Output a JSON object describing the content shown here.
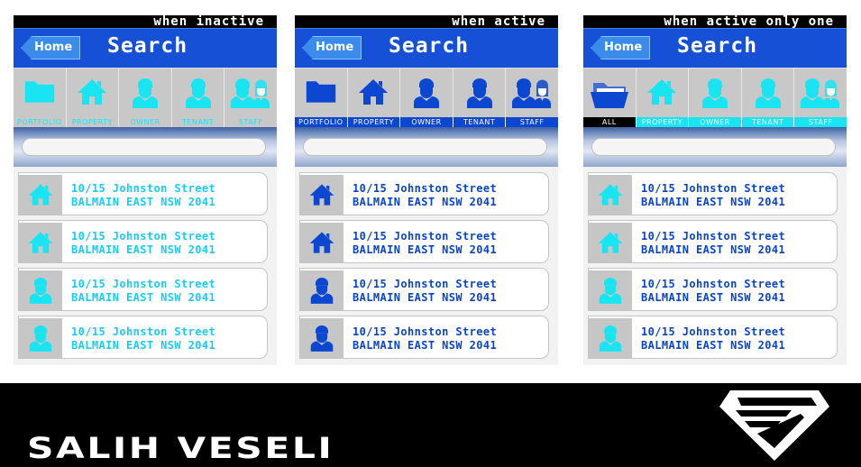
{
  "app": {
    "home_label": "Home",
    "title": "Search"
  },
  "colors": {
    "header_blue": "#1550d6",
    "cyan": "#19e5f2",
    "active_blue": "#0c47d1",
    "tab_bg": "#c8c8c8"
  },
  "panels": [
    {
      "caption": "when inactive",
      "tabs": [
        {
          "label": "PORTFOLIO",
          "icon": "folder-icon"
        },
        {
          "label": "PROPERTY",
          "icon": "house-icon"
        },
        {
          "label": "OWNER",
          "icon": "person-icon"
        },
        {
          "label": "TENANT",
          "icon": "person-icon"
        },
        {
          "label": "STAFF",
          "icon": "staff-icon"
        }
      ],
      "rows": [
        {
          "line1": "10/15 Johnston Street",
          "line2": "BALMAIN EAST NSW 2041",
          "icon": "house-icon"
        },
        {
          "line1": "10/15 Johnston Street",
          "line2": "BALMAIN EAST NSW 2041",
          "icon": "house-icon"
        },
        {
          "line1": "10/15 Johnston Street",
          "line2": "BALMAIN EAST NSW 2041",
          "icon": "person-icon"
        },
        {
          "line1": "10/15 Johnston Street",
          "line2": "BALMAIN EAST NSW 2041",
          "icon": "person-icon"
        }
      ]
    },
    {
      "caption": "when active",
      "tabs": [
        {
          "label": "PORTFOLIO",
          "icon": "folder-icon"
        },
        {
          "label": "PROPERTY",
          "icon": "house-icon"
        },
        {
          "label": "OWNER",
          "icon": "person-icon"
        },
        {
          "label": "TENANT",
          "icon": "person-icon"
        },
        {
          "label": "STAFF",
          "icon": "staff-icon"
        }
      ],
      "rows": [
        {
          "line1": "10/15 Johnston Street",
          "line2": "BALMAIN EAST NSW 2041",
          "icon": "house-icon"
        },
        {
          "line1": "10/15 Johnston Street",
          "line2": "BALMAIN EAST NSW 2041",
          "icon": "house-icon"
        },
        {
          "line1": "10/15 Johnston Street",
          "line2": "BALMAIN EAST NSW 2041",
          "icon": "person-icon"
        },
        {
          "line1": "10/15 Johnston Street",
          "line2": "BALMAIN EAST NSW 2041",
          "icon": "person-icon"
        }
      ]
    },
    {
      "caption": "when active only one",
      "tabs": [
        {
          "label": "ALL",
          "icon": "folder-open-icon"
        },
        {
          "label": "PROPERTY",
          "icon": "house-icon"
        },
        {
          "label": "OWNER",
          "icon": "person-icon"
        },
        {
          "label": "TENANT",
          "icon": "person-icon"
        },
        {
          "label": "STAFF",
          "icon": "staff-icon"
        }
      ],
      "rows": [
        {
          "line1": "10/15 Johnston Street",
          "line2": "BALMAIN EAST NSW 2041",
          "icon": "house-icon"
        },
        {
          "line1": "10/15 Johnston Street",
          "line2": "BALMAIN EAST NSW 2041",
          "icon": "house-icon"
        },
        {
          "line1": "10/15 Johnston Street",
          "line2": "BALMAIN EAST NSW 2041",
          "icon": "person-icon"
        },
        {
          "line1": "10/15 Johnston Street",
          "line2": "BALMAIN EAST NSW 2041",
          "icon": "person-icon"
        }
      ]
    }
  ],
  "footer": {
    "brand": "SALIH VESELI",
    "logo": "superman-shield-logo"
  }
}
